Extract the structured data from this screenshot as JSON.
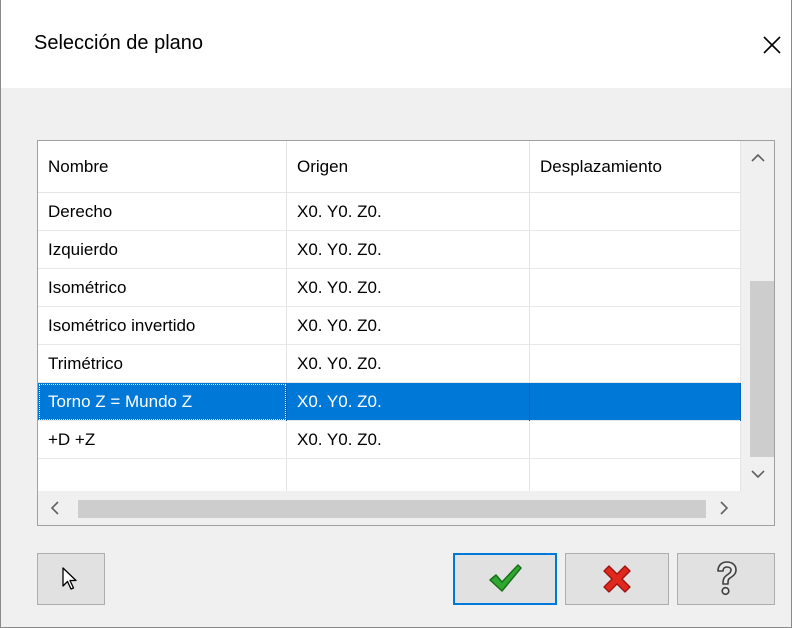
{
  "window": {
    "title": "Selección de plano",
    "close_icon": "close-icon"
  },
  "grid": {
    "columns": [
      "Nombre",
      "Origen",
      "Desplazamiento"
    ],
    "rows": [
      {
        "name": "Derecho",
        "origin": "X0. Y0. Z0.",
        "offset": ""
      },
      {
        "name": "Izquierdo",
        "origin": "X0. Y0. Z0.",
        "offset": ""
      },
      {
        "name": "Isométrico",
        "origin": "X0. Y0. Z0.",
        "offset": ""
      },
      {
        "name": "Isométrico invertido",
        "origin": "X0. Y0. Z0.",
        "offset": ""
      },
      {
        "name": "Trimétrico",
        "origin": "X0. Y0. Z0.",
        "offset": ""
      },
      {
        "name": "Torno Z = Mundo Z",
        "origin": "X0. Y0. Z0.",
        "offset": ""
      },
      {
        "name": "+D +Z",
        "origin": "X0. Y0. Z0.",
        "offset": ""
      },
      {
        "name": "",
        "origin": "",
        "offset": ""
      }
    ],
    "selected_row": "Torno Z = Mundo Z"
  },
  "buttons": {
    "select_icon": "cursor-arrow-icon",
    "ok_icon": "checkmark-icon",
    "cancel_icon": "red-x-icon",
    "help_icon": "question-mark-icon"
  },
  "colors": {
    "selection": "#0078d7",
    "ok_green": "#2fa82f",
    "cancel_red": "#e0281e",
    "background": "#f0f0f0"
  }
}
